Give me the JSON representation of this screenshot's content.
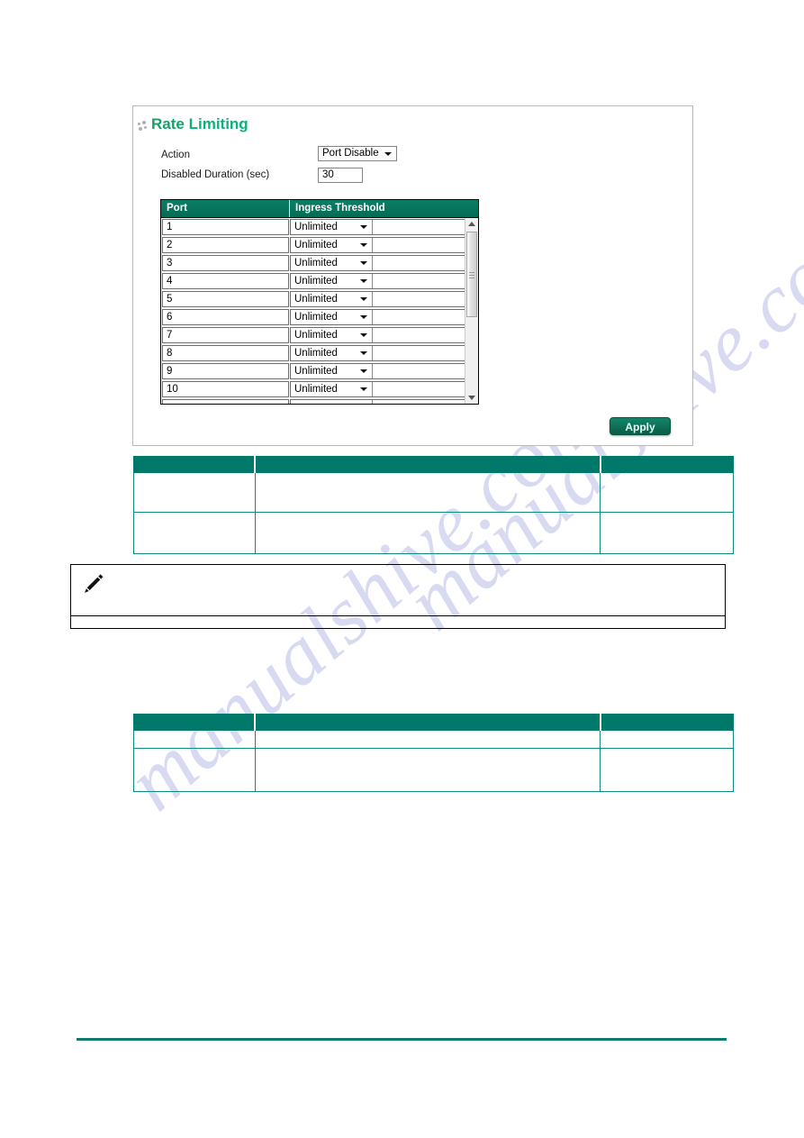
{
  "page": {
    "watermark": "manualshive.com"
  },
  "panel": {
    "icon": "dots-cluster-icon",
    "title_word1": "Rate",
    "title_word2": "Limiting",
    "accent_color": "#00796b",
    "title_color": "#0fb07d",
    "fields": {
      "action_label": "Action",
      "action_value": "Port Disable",
      "action_options": [
        "Port Disable"
      ],
      "duration_label": "Disabled Duration (sec)",
      "duration_value": "30"
    },
    "ports_table": {
      "headers": [
        "Port",
        "Ingress Threshold"
      ],
      "rows": [
        {
          "port": "1",
          "threshold": "Unlimited"
        },
        {
          "port": "2",
          "threshold": "Unlimited"
        },
        {
          "port": "3",
          "threshold": "Unlimited"
        },
        {
          "port": "4",
          "threshold": "Unlimited"
        },
        {
          "port": "5",
          "threshold": "Unlimited"
        },
        {
          "port": "6",
          "threshold": "Unlimited"
        },
        {
          "port": "7",
          "threshold": "Unlimited"
        },
        {
          "port": "8",
          "threshold": "Unlimited"
        },
        {
          "port": "9",
          "threshold": "Unlimited"
        },
        {
          "port": "10",
          "threshold": "Unlimited"
        },
        {
          "port": "",
          "threshold": ""
        }
      ],
      "threshold_options": [
        "Unlimited"
      ]
    },
    "apply_label": "Apply"
  },
  "table_one": {
    "headers": [
      "",
      "",
      ""
    ],
    "rows": [
      [
        "",
        "",
        ""
      ],
      [
        "",
        "",
        ""
      ]
    ]
  },
  "table_two": {
    "headers": [
      "",
      "",
      ""
    ],
    "rows": [
      [
        "",
        "",
        ""
      ],
      [
        "",
        "",
        ""
      ]
    ]
  },
  "note": {
    "icon": "pencil-icon",
    "text": "",
    "body": ""
  }
}
